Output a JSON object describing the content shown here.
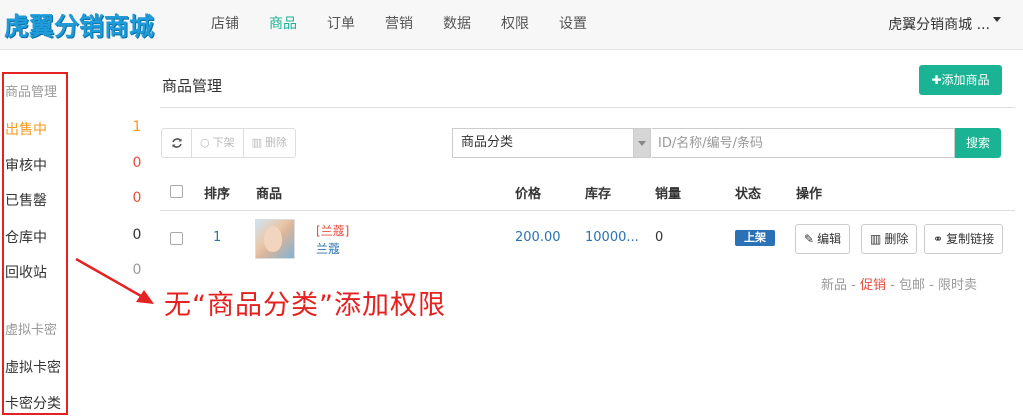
{
  "header": {
    "logo_text": "虎翼分销商城",
    "nav": [
      "店铺",
      "商品",
      "订单",
      "营销",
      "数据",
      "权限",
      "设置"
    ],
    "active_nav": "商品",
    "user_menu": "虎翼分销商城 ..."
  },
  "sidebar": {
    "group1": "商品管理",
    "items": [
      {
        "label": "出售中",
        "count": "1"
      },
      {
        "label": "审核中",
        "count": "0"
      },
      {
        "label": "已售罄",
        "count": "0"
      },
      {
        "label": "仓库中",
        "count": "0"
      },
      {
        "label": "回收站",
        "count": "0"
      }
    ],
    "group2": "虚拟卡密",
    "items2": [
      {
        "label": "虚拟卡密"
      },
      {
        "label": "卡密分类"
      }
    ]
  },
  "main": {
    "title": "商品管理",
    "add_button": "添加商品",
    "toolbar": {
      "off_shelf": "下架",
      "delete": "删除"
    },
    "category_select": "商品分类",
    "search_placeholder": "ID/名称/编号/条码",
    "search_button": "搜索",
    "columns": [
      "排序",
      "商品",
      "价格",
      "库存",
      "销量",
      "状态",
      "操作"
    ],
    "rows": [
      {
        "order": "1",
        "tag": "[兰蔻]",
        "name": "兰蔻",
        "price": "200.00",
        "stock": "10000...",
        "sales": "0",
        "status": "上架",
        "actions": {
          "edit": "编辑",
          "delete": "删除",
          "copy_link": "复制链接"
        }
      }
    ],
    "promo": {
      "new": "新品",
      "sep": " - ",
      "hot": "促销",
      "free_ship": "包邮",
      "limited": "限时卖"
    }
  },
  "annotation": "无“商品分类”添加权限",
  "colors": {
    "accent": "#1ab394",
    "active_side": "#f79a1e",
    "annotation": "#e52222",
    "link": "#2a72b5"
  }
}
